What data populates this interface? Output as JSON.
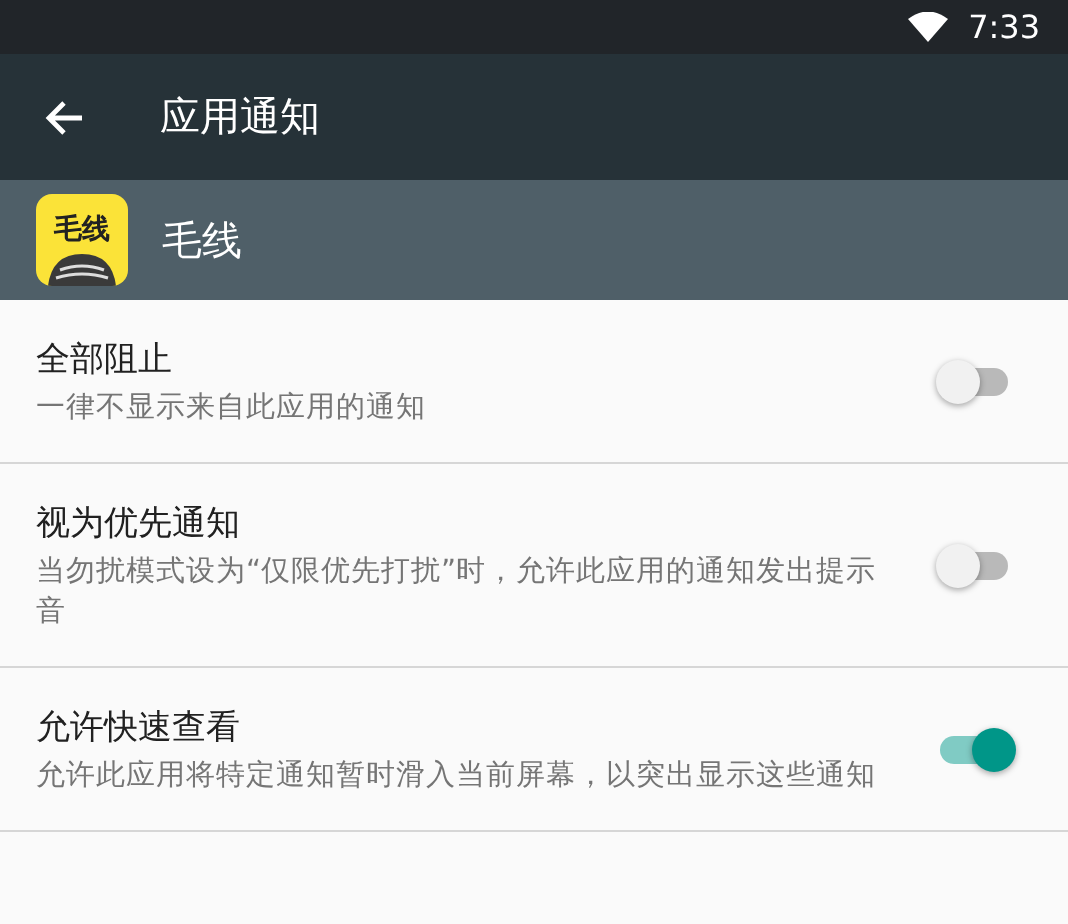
{
  "status_bar": {
    "time": "7:33"
  },
  "app_bar": {
    "title": "应用通知"
  },
  "app_header": {
    "icon_text": "毛线",
    "name": "毛线"
  },
  "settings": [
    {
      "title": "全部阻止",
      "description": "一律不显示来自此应用的通知",
      "on": false
    },
    {
      "title": "视为优先通知",
      "description": "当勿扰模式设为“仅限优先打扰”时，允许此应用的通知发出提示音",
      "on": false
    },
    {
      "title": "允许快速查看",
      "description": "允许此应用将特定通知暂时滑入当前屏幕，以突出显示这些通知",
      "on": true
    }
  ]
}
